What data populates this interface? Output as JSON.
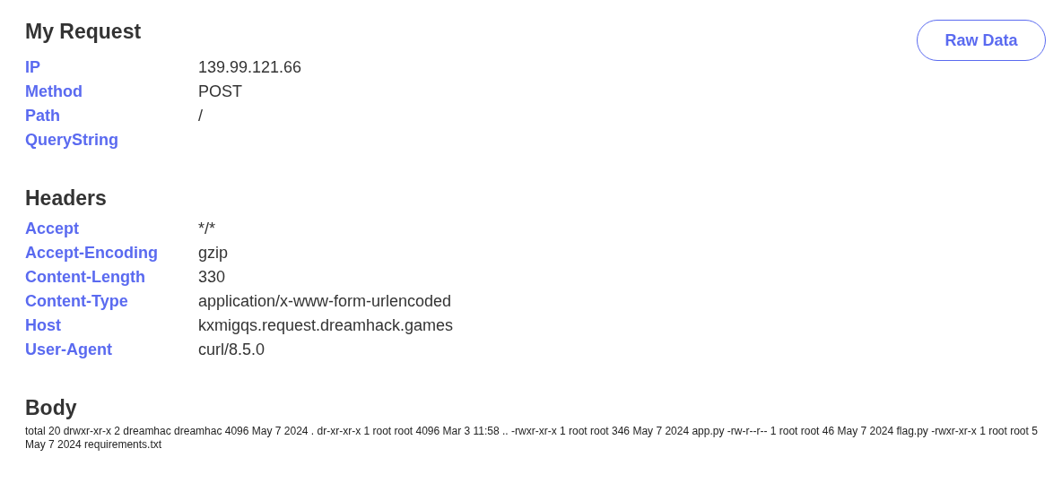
{
  "request": {
    "title": "My Request",
    "button": "Raw Data",
    "fields": [
      {
        "label": "IP",
        "value": "139.99.121.66"
      },
      {
        "label": "Method",
        "value": "POST"
      },
      {
        "label": "Path",
        "value": "/"
      },
      {
        "label": "QueryString"
      }
    ]
  },
  "headers": {
    "title": "Headers",
    "fields": [
      {
        "label": "Accept",
        "value": "*/*"
      },
      {
        "label": "Accept-Encoding",
        "value": "gzip"
      },
      {
        "label": "Content-Length",
        "value": "330"
      },
      {
        "label": "Content-Type",
        "value": "application/x-www-form-urlencoded"
      },
      {
        "label": "Host",
        "value": "kxmigqs.request.dreamhack.games"
      },
      {
        "label": "User-Agent",
        "value": "curl/8.5.0"
      }
    ]
  },
  "body": {
    "title": "Body",
    "text": "total 20 drwxr-xr-x 2 dreamhac dreamhac 4096 May 7 2024 . dr-xr-xr-x 1 root root 4096 Mar 3 11:58 .. -rwxr-xr-x 1 root root 346 May 7 2024 app.py -rw-r--r-- 1 root root 46 May 7 2024 flag.py -rwxr-xr-x 1 root root 5 May 7 2024 requirements.txt"
  }
}
